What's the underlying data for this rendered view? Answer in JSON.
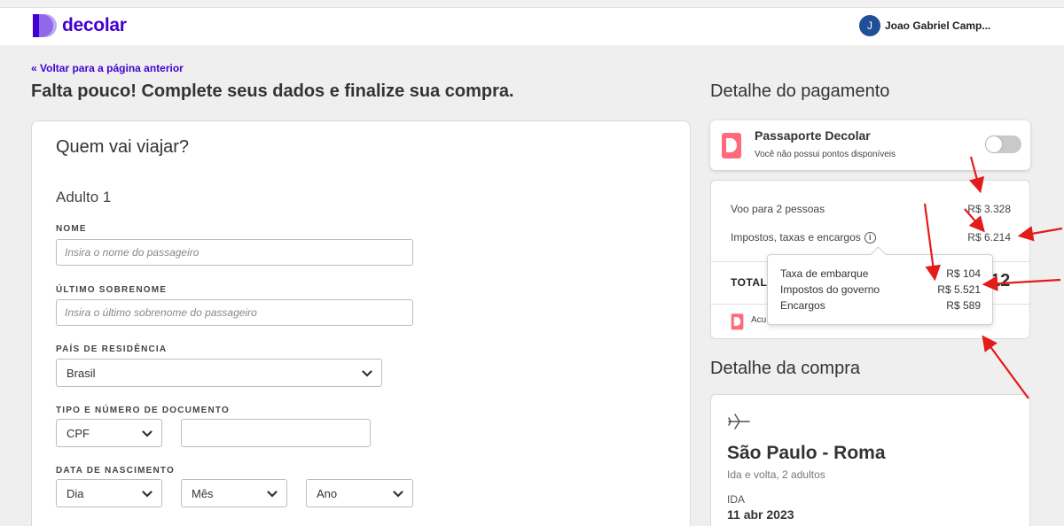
{
  "header": {
    "logo_text": "decolar",
    "user_initial": "J",
    "user_name": "Joao Gabriel Camp..."
  },
  "nav": {
    "back_link": "« Voltar para a página anterior"
  },
  "page_title": "Falta pouco! Complete seus dados e finalize sua compra.",
  "form": {
    "title": "Quem vai viajar?",
    "adult_label": "Adulto 1",
    "nome": {
      "label": "NOME",
      "placeholder": "Insira o nome do passageiro"
    },
    "sobrenome": {
      "label": "ÚLTIMO SOBRENOME",
      "placeholder": "Insira o último sobrenome do passageiro"
    },
    "pais": {
      "label": "PAÍS DE RESIDÊNCIA",
      "value": "Brasil"
    },
    "documento": {
      "label": "TIPO E NÚMERO DE DOCUMENTO",
      "type_value": "CPF",
      "number_value": ""
    },
    "nascimento": {
      "label": "DATA DE NASCIMENTO",
      "day": "Dia",
      "month": "Mês",
      "year": "Ano"
    }
  },
  "payment": {
    "section_title": "Detalhe do pagamento",
    "passport": {
      "title": "Passaporte Decolar",
      "subtitle": "Você não possui pontos disponíveis",
      "toggle_on": false
    },
    "voo_label": "Voo para 2 pessoas",
    "voo_value": "R$ 3.328",
    "impostos_label": "Impostos, taxas e encargos",
    "impostos_value": "R$ 6.214",
    "total_label": "TOTAL",
    "total_value_visible": "12",
    "accumulate_text_visible": "Acu"
  },
  "tooltip": {
    "rows": [
      {
        "label": "Taxa de embarque",
        "value": "R$ 104"
      },
      {
        "label": "Impostos do governo",
        "value": "R$ 5.521"
      },
      {
        "label": "Encargos",
        "value": "R$ 589"
      }
    ]
  },
  "purchase": {
    "section_title": "Detalhe da compra",
    "route": "São Paulo - Roma",
    "route_sub": "Ida e volta, 2 adultos",
    "ida_label": "IDA",
    "ida_date": "11 abr 2023"
  },
  "colors": {
    "brand_purple": "#4300d2",
    "annotation_red": "#e21b1b",
    "passport_pink": "#ff6b7a"
  },
  "icons": [
    "decolar-logo-icon",
    "chevron-down-icon",
    "info-icon",
    "passport-icon",
    "plane-icon"
  ]
}
